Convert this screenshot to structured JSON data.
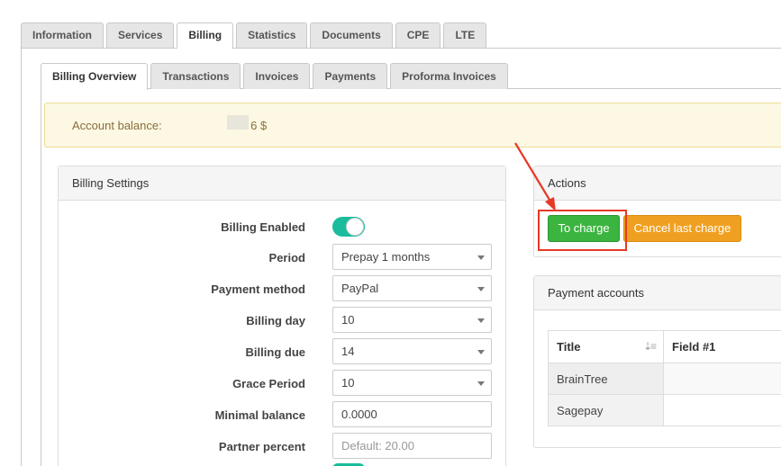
{
  "top_tabs": [
    "Information",
    "Services",
    "Billing",
    "Statistics",
    "Documents",
    "CPE",
    "LTE"
  ],
  "top_active": 2,
  "sub_tabs": [
    "Billing Overview",
    "Transactions",
    "Invoices",
    "Payments",
    "Proforma Invoices"
  ],
  "sub_active": 0,
  "account": {
    "label": "Account balance:",
    "value_suffix": "6 $"
  },
  "billing_settings": {
    "title": "Billing Settings",
    "fields": {
      "enabled": {
        "label": "Billing Enabled",
        "on": true
      },
      "period": {
        "label": "Period",
        "value": "Prepay 1 months"
      },
      "payment_method": {
        "label": "Payment method",
        "value": "PayPal"
      },
      "billing_day": {
        "label": "Billing day",
        "value": "10"
      },
      "billing_due": {
        "label": "Billing due",
        "value": "14"
      },
      "grace_period": {
        "label": "Grace Period",
        "value": "10"
      },
      "minimal_balance": {
        "label": "Minimal balance",
        "value": "0.0000"
      },
      "partner_percent": {
        "label": "Partner percent",
        "placeholder": "Default: 20.00"
      }
    }
  },
  "actions": {
    "title": "Actions",
    "charge_label": "To charge",
    "cancel_label": "Cancel last charge"
  },
  "payment_accounts": {
    "title": "Payment accounts",
    "columns": [
      "Title",
      "Field #1"
    ],
    "rows": [
      [
        "BrainTree",
        ""
      ],
      [
        "Sagepay",
        ""
      ]
    ]
  },
  "colors": {
    "accent_green": "#3cb540",
    "accent_orange": "#f0a020",
    "toggle_on": "#1abc9c",
    "highlight_red": "#e53a26"
  }
}
